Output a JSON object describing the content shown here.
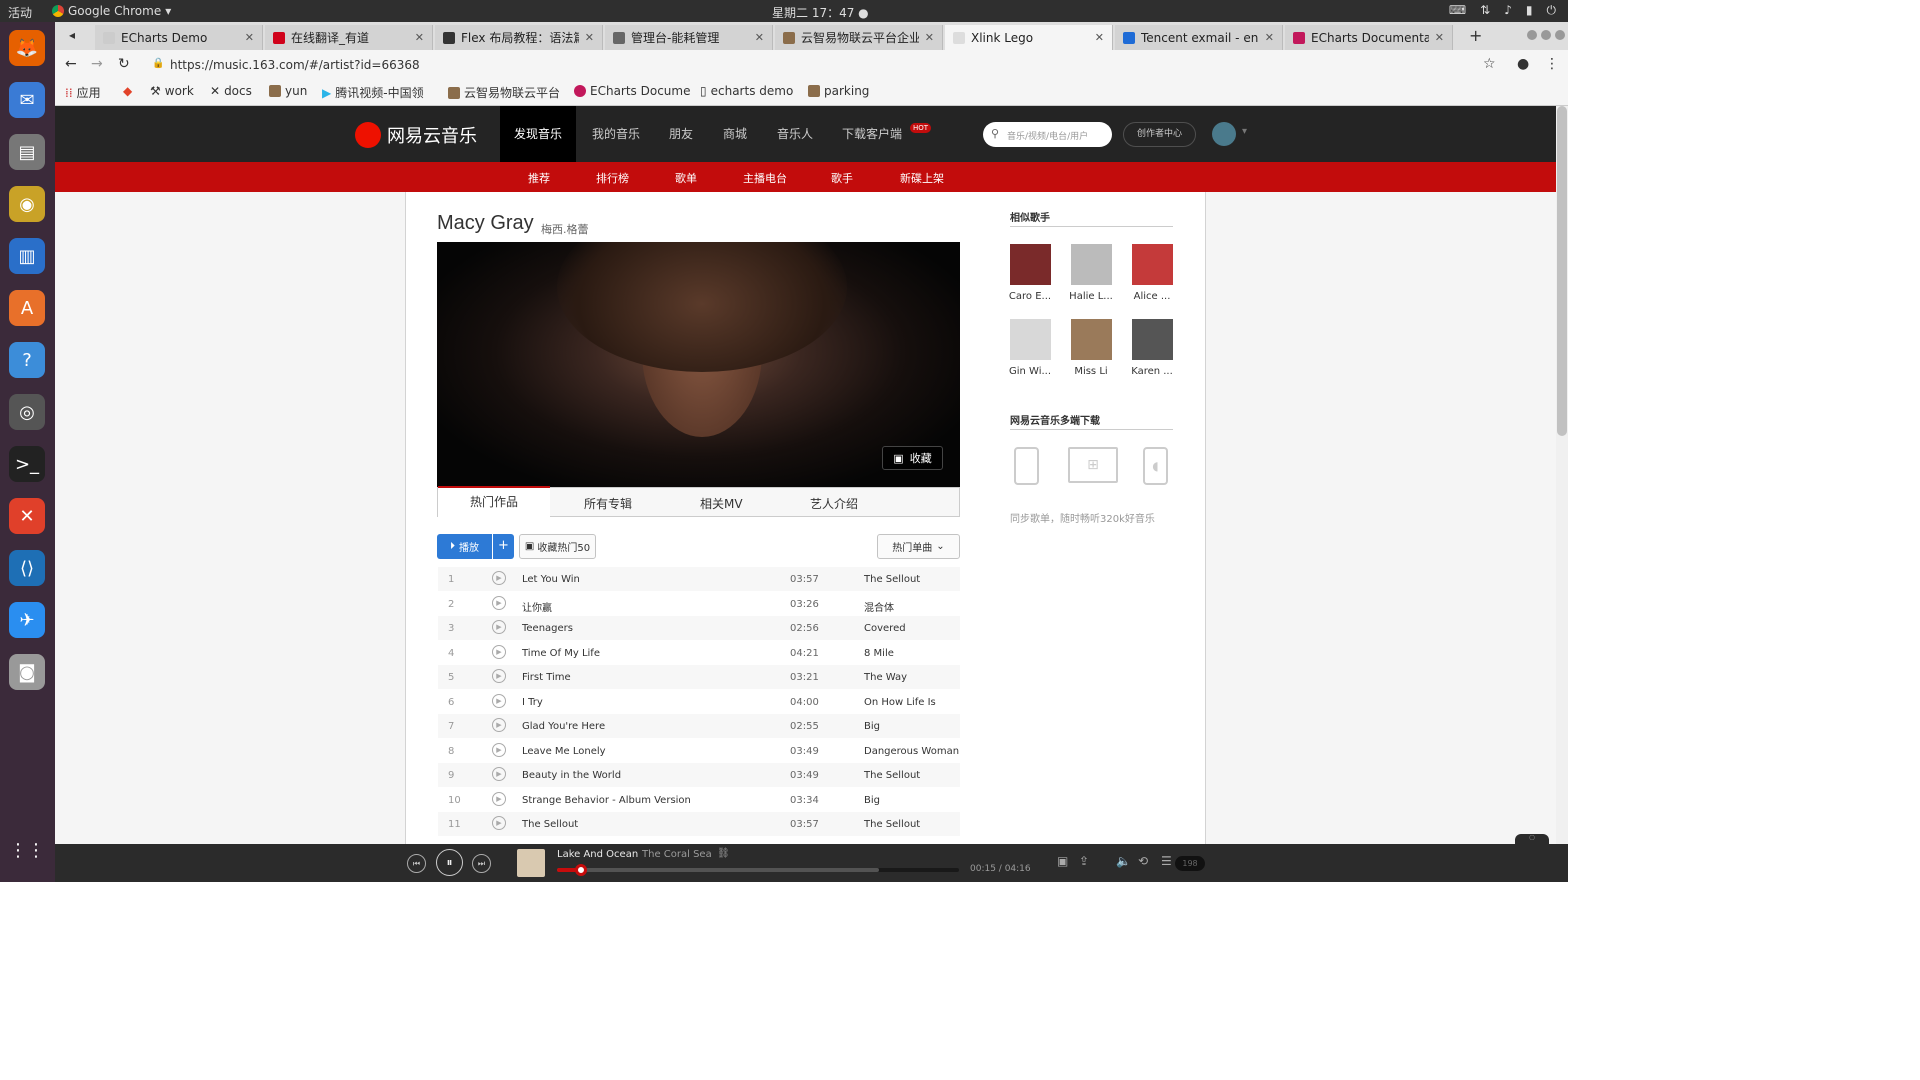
{
  "system": {
    "activities": "活动",
    "app_name": "Google Chrome",
    "clock": "星期二 17：47"
  },
  "tabs": [
    {
      "label": "ECharts Demo",
      "color": "#cccccc"
    },
    {
      "label": "在线翻译_有道",
      "color": "#d0021b"
    },
    {
      "label": "Flex 布局教程：语法篇",
      "color": "#333333"
    },
    {
      "label": "管理台-能耗管理",
      "color": "#666666"
    },
    {
      "label": "云智易物联云平台企业",
      "color": "#8b6d4b"
    },
    {
      "label": "Xlink Lego",
      "color": "#dddddd"
    },
    {
      "label": "Tencent exmail - engl",
      "color": "#1e6bd6"
    },
    {
      "label": "ECharts Documentat",
      "color": "#c2185b"
    }
  ],
  "address": {
    "url": "https://music.163.com/#/artist?id=66368"
  },
  "bookmarks": [
    {
      "label": "应用"
    },
    {
      "label": ""
    },
    {
      "label": "work"
    },
    {
      "label": "docs"
    },
    {
      "label": "yun"
    },
    {
      "label": "腾讯视频-中国领"
    },
    {
      "label": "云智易物联云平台"
    },
    {
      "label": "ECharts Docume"
    },
    {
      "label": "echarts demo"
    },
    {
      "label": "parking"
    }
  ],
  "nav": {
    "logo": "网易云音乐",
    "items": [
      "发现音乐",
      "我的音乐",
      "朋友",
      "商城",
      "音乐人",
      "下载客户端"
    ],
    "hot_badge": "HOT",
    "search_placeholder": "音乐/视频/电台/用户",
    "creator": "创作者中心"
  },
  "subnav": [
    "推荐",
    "排行榜",
    "歌单",
    "主播电台",
    "歌手",
    "新碟上架"
  ],
  "artist": {
    "name": "Macy Gray",
    "alias": "梅西.格蕾",
    "collect": "收藏"
  },
  "artist_tabs": [
    "热门作品",
    "所有专辑",
    "相关MV",
    "艺人介绍"
  ],
  "actions": {
    "play": "播放",
    "add": "+",
    "collect_hot": "收藏热门50",
    "sort": "热门单曲"
  },
  "tracks": [
    {
      "num": "1",
      "title": "Let You Win",
      "dur": "03:57",
      "album": "The Sellout"
    },
    {
      "num": "2",
      "title": "让你赢",
      "dur": "03:26",
      "album": "混合体"
    },
    {
      "num": "3",
      "title": "Teenagers",
      "dur": "02:56",
      "album": "Covered"
    },
    {
      "num": "4",
      "title": "Time Of My Life",
      "dur": "04:21",
      "album": "8 Mile"
    },
    {
      "num": "5",
      "title": "First Time",
      "dur": "03:21",
      "album": "The Way"
    },
    {
      "num": "6",
      "title": "I Try",
      "dur": "04:00",
      "album": "On How Life Is"
    },
    {
      "num": "7",
      "title": "Glad You're Here",
      "dur": "02:55",
      "album": "Big"
    },
    {
      "num": "8",
      "title": "Leave Me Lonely",
      "dur": "03:49",
      "album": "Dangerous Woman"
    },
    {
      "num": "9",
      "title": "Beauty in the World",
      "dur": "03:49",
      "album": "The Sellout"
    },
    {
      "num": "10",
      "title": "Strange Behavior - Album Version",
      "dur": "03:34",
      "album": "Big"
    },
    {
      "num": "11",
      "title": "The Sellout",
      "dur": "03:57",
      "album": "The Sellout"
    }
  ],
  "sidebar": {
    "similar_title": "相似歌手",
    "similar": [
      "Caro E...",
      "Halie L...",
      "Alice ...",
      "Gin Wi...",
      "Miss Li",
      "Karen ..."
    ],
    "download_title": "网易云音乐多端下载",
    "sync_text": "同步歌单，随时畅听320k好音乐"
  },
  "player": {
    "song": "Lake And Ocean",
    "artist": "The Coral Sea",
    "time": "00:15 / 04:16",
    "progress": 0.06,
    "count": "198"
  }
}
